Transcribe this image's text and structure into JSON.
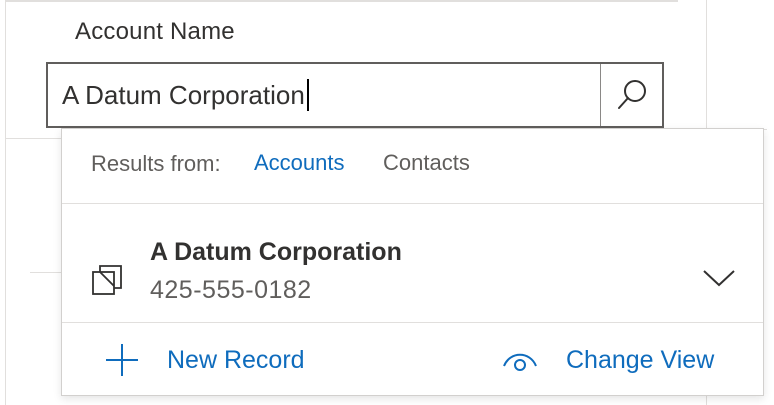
{
  "field": {
    "label": "Account Name",
    "value": "A Datum Corporation"
  },
  "search": {
    "icon": "search-icon"
  },
  "flyout": {
    "results_from_label": "Results from:",
    "tabs": [
      {
        "label": "Accounts",
        "active": true
      },
      {
        "label": "Contacts",
        "active": false
      }
    ],
    "records": [
      {
        "name": "A Datum Corporation",
        "phone": "425-555-0182",
        "icon": "account-icon"
      }
    ],
    "actions": {
      "new_record": "New Record",
      "change_view": "Change View"
    }
  },
  "colors": {
    "accent": "#0f6cbd",
    "text": "#323130",
    "secondary_text": "#605e5c",
    "border": "#605e5c"
  }
}
